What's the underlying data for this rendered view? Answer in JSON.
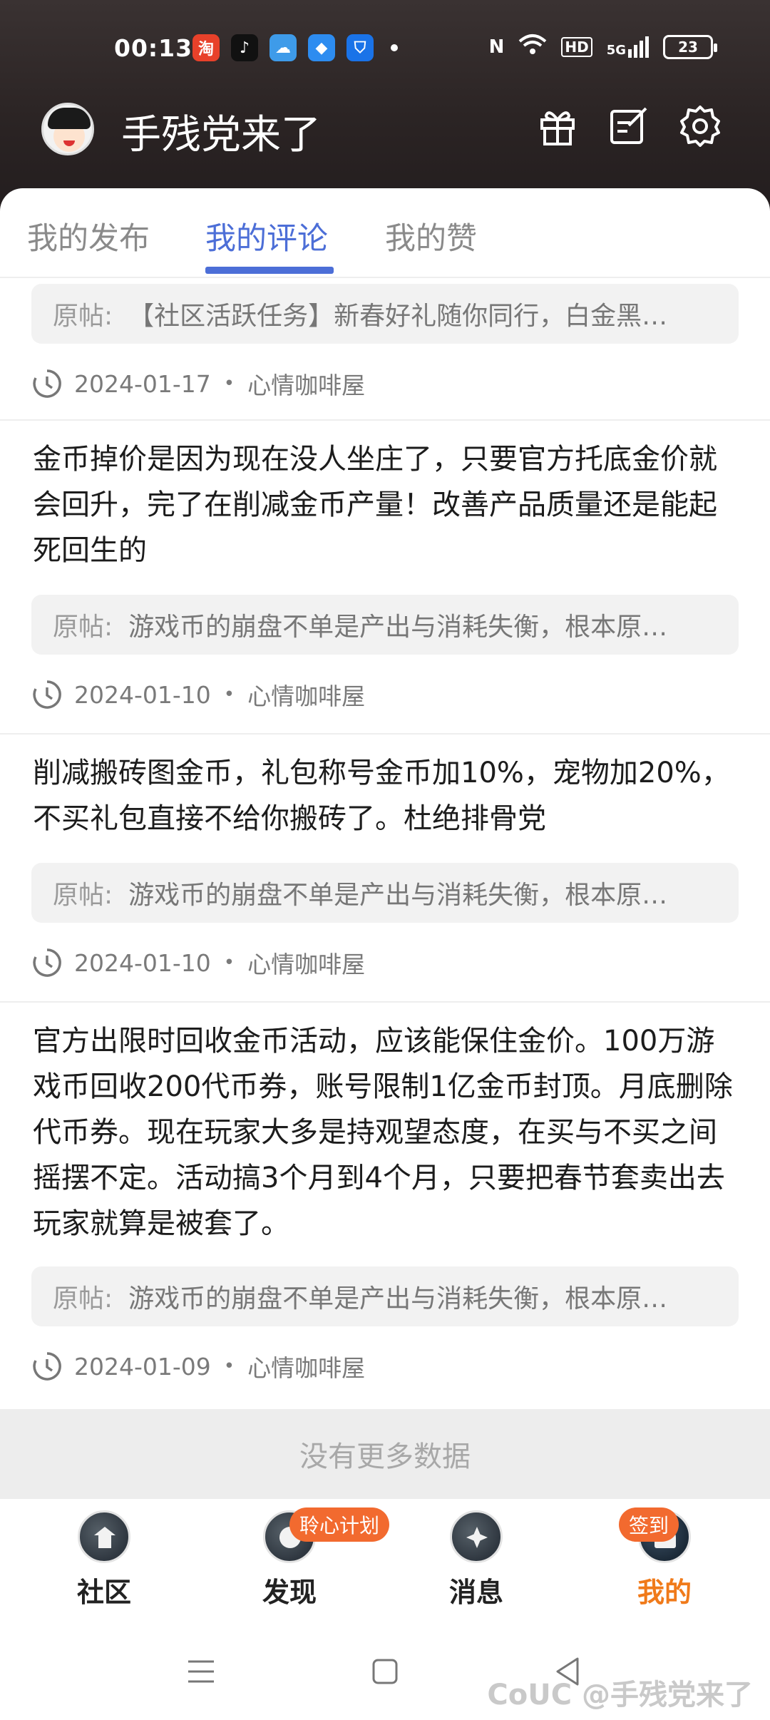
{
  "status_bar": {
    "time": "00:13",
    "battery": "23",
    "signal": "5G",
    "hd": "HD"
  },
  "header": {
    "username": "手残党来了"
  },
  "tabs": [
    {
      "label": "我的发布"
    },
    {
      "label": "我的评论"
    },
    {
      "label": "我的赞"
    }
  ],
  "feed": {
    "orig_label": "原帖:",
    "items": [
      {
        "text": "",
        "orig_title": "【社区活跃任务】新春好礼随你同行，白金黑…",
        "date": "2024-01-17",
        "board": "心情咖啡屋"
      },
      {
        "text": "金币掉价是因为现在没人坐庄了，只要官方托底金价就会回升，完了在削减金币产量！改善产品质量还是能起死回生的",
        "orig_title": "游戏币的崩盘不单是产出与消耗失衡，根本原…",
        "date": "2024-01-10",
        "board": "心情咖啡屋"
      },
      {
        "text": "削减搬砖图金币，礼包称号金币加10%，宠物加20%，不买礼包直接不给你搬砖了。杜绝排骨党",
        "orig_title": "游戏币的崩盘不单是产出与消耗失衡，根本原…",
        "date": "2024-01-10",
        "board": "心情咖啡屋"
      },
      {
        "text": "官方出限时回收金币活动，应该能保住金价。100万游戏币回收200代币券，账号限制1亿金币封顶。月底删除代币券。现在玩家大多是持观望态度，在买与不买之间摇摆不定。活动搞3个月到4个月，只要把春节套卖出去玩家就算是被套了。",
        "orig_title": "游戏币的崩盘不单是产出与消耗失衡，根本原…",
        "date": "2024-01-09",
        "board": "心情咖啡屋"
      }
    ],
    "no_more": "没有更多数据"
  },
  "bottom_nav": [
    {
      "label": "社区",
      "badge": ""
    },
    {
      "label": "发现",
      "badge": "聆心计划"
    },
    {
      "label": "消息",
      "badge": ""
    },
    {
      "label": "我的",
      "badge": "签到"
    }
  ],
  "watermark": "CoUC @手残党来了",
  "colors": {
    "accent": "#4c6ed7",
    "active_nav": "#f07a1a",
    "badge": "#f26a2f"
  }
}
